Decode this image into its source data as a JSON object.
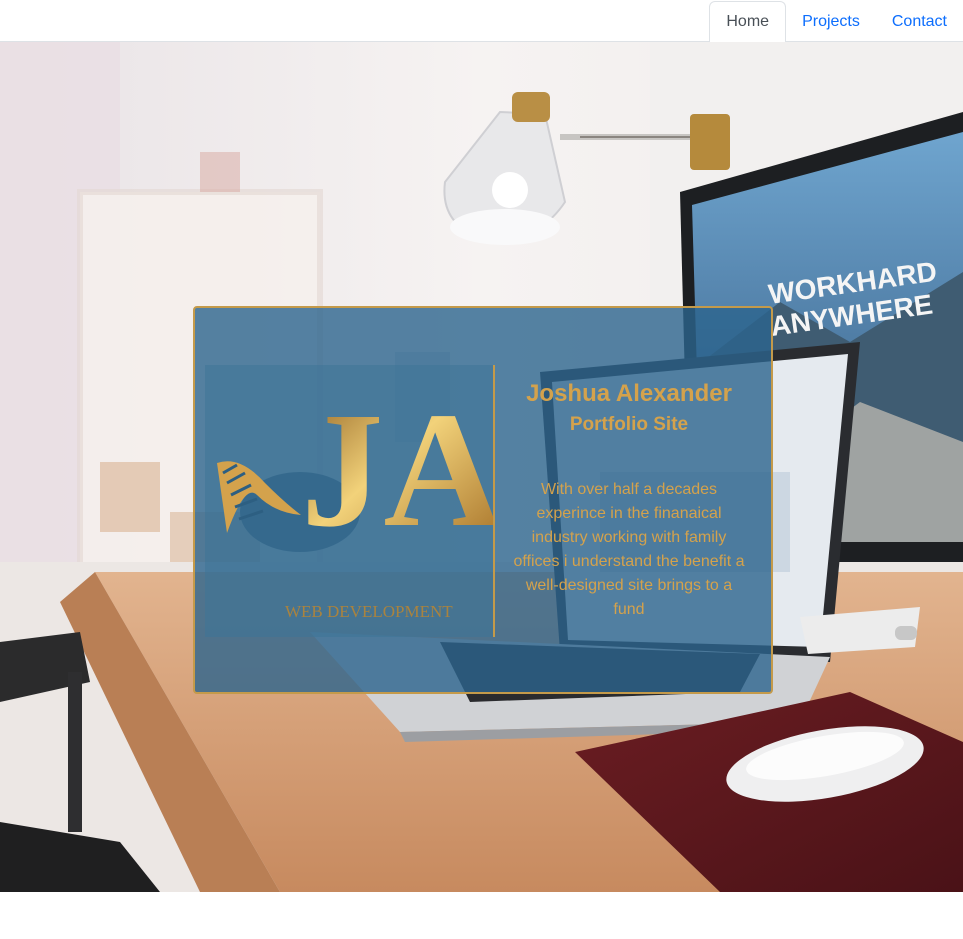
{
  "nav": {
    "items": [
      {
        "label": "Home",
        "active": true
      },
      {
        "label": "Projects",
        "active": false
      },
      {
        "label": "Contact",
        "active": false
      }
    ]
  },
  "hero": {
    "card": {
      "logo": {
        "letters": "JA",
        "tagline": "WEB DEVELOPMENT"
      },
      "name": "Joshua Alexander",
      "subtitle": "Portfolio Site",
      "description": "With over half a decades experince in the finanaical industry working with family offices i understand the benefit a well-designed site brings to a fund"
    },
    "monitor_text": [
      "WORKHARD",
      "ANYWHERE"
    ]
  },
  "colors": {
    "accent_gold": "#d4a24c",
    "card_border": "#c49a4a",
    "card_bg": "#2c648d",
    "nav_link": "#0d6efd",
    "nav_active": "#495057"
  }
}
